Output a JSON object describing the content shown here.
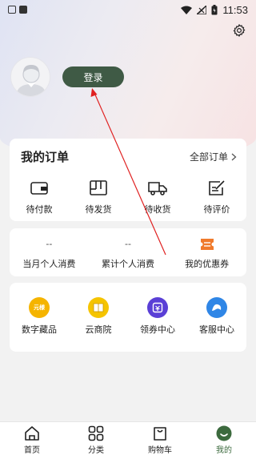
{
  "status_bar": {
    "time": "11:53"
  },
  "header": {
    "login_label": "登录"
  },
  "orders": {
    "title": "我的订单",
    "all_label": "全部订单",
    "items": [
      {
        "label": "待付款",
        "icon": "wallet-icon"
      },
      {
        "label": "待发货",
        "icon": "package-icon"
      },
      {
        "label": "待收货",
        "icon": "truck-icon"
      },
      {
        "label": "待评价",
        "icon": "review-icon"
      }
    ]
  },
  "stats": [
    {
      "value": "--",
      "label": "当月个人消费"
    },
    {
      "value": "--",
      "label": "累计个人消费"
    },
    {
      "value": "",
      "label": "我的优惠券",
      "icon": "coupon-icon"
    }
  ],
  "services": [
    {
      "label": "数字藏品",
      "icon": "digital-collection-icon",
      "badge": "元様",
      "color": "#f5b400"
    },
    {
      "label": "云商院",
      "icon": "book-icon",
      "color": "#f5c400"
    },
    {
      "label": "领券中心",
      "icon": "ticket-icon",
      "color": "#5a3fd6"
    },
    {
      "label": "客服中心",
      "icon": "support-icon",
      "color": "#2f86e6"
    }
  ],
  "tabbar": [
    {
      "label": "首页",
      "icon": "home-icon",
      "active": false
    },
    {
      "label": "分类",
      "icon": "category-icon",
      "active": false
    },
    {
      "label": "购物车",
      "icon": "cart-icon",
      "active": false
    },
    {
      "label": "我的",
      "icon": "profile-icon",
      "active": true
    }
  ],
  "colors": {
    "accent": "#3f5a45",
    "active_tab": "#3c6a3e",
    "annotation": "#e02020"
  }
}
